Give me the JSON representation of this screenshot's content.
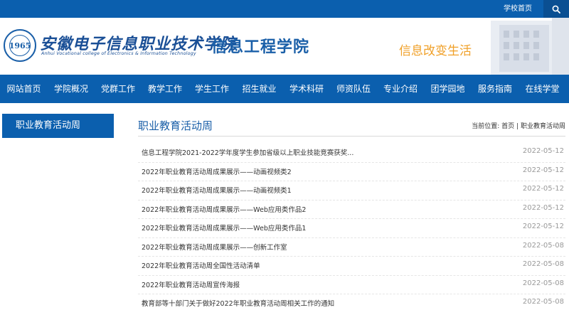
{
  "topbar": {
    "school_home": "学校首页",
    "search_icon": "search-icon"
  },
  "header": {
    "logo_mark": "1965",
    "school_name_cn": "安徽电子信息职业技术学院",
    "school_name_en": "Anhui Vocational college of Electronics & Information Technology",
    "department": "信息工程学院",
    "slogan": "信息改变生活"
  },
  "nav": {
    "items": [
      "网站首页",
      "学院概况",
      "党群工作",
      "教学工作",
      "学生工作",
      "招生就业",
      "学术科研",
      "师资队伍",
      "专业介绍",
      "团学园地",
      "服务指南",
      "在线学堂"
    ]
  },
  "sidebar": {
    "title": "职业教育活动周"
  },
  "main": {
    "title": "职业教育活动周",
    "breadcrumb_prefix": "当前位置:",
    "breadcrumb_home": "首页",
    "breadcrumb_sep": "|",
    "breadcrumb_current": "职业教育活动周",
    "articles": [
      {
        "title": "信息工程学院2021-2022学年度学生参加省级以上职业技能竞赛获奖...",
        "date": "2022-05-12"
      },
      {
        "title": "2022年职业教育活动周成果展示——动画视频类2",
        "date": "2022-05-12"
      },
      {
        "title": "2022年职业教育活动周成果展示——动画视频类1",
        "date": "2022-05-12"
      },
      {
        "title": "2022年职业教育活动周成果展示——Web应用类作品2",
        "date": "2022-05-12"
      },
      {
        "title": "2022年职业教育活动周成果展示——Web应用类作品1",
        "date": "2022-05-12"
      },
      {
        "title": "2022年职业教育活动周成果展示——创新工作室",
        "date": "2022-05-08"
      },
      {
        "title": "2022年职业教育活动周全国性活动清单",
        "date": "2022-05-08"
      },
      {
        "title": "2022年职业教育活动周宣传海报",
        "date": "2022-05-08"
      },
      {
        "title": "教育部等十部门关于做好2022年职业教育活动周相关工作的通知",
        "date": "2022-05-08"
      }
    ]
  },
  "colors": {
    "primary": "#0b5fae",
    "slogan": "#f0a028",
    "date": "#999999"
  }
}
